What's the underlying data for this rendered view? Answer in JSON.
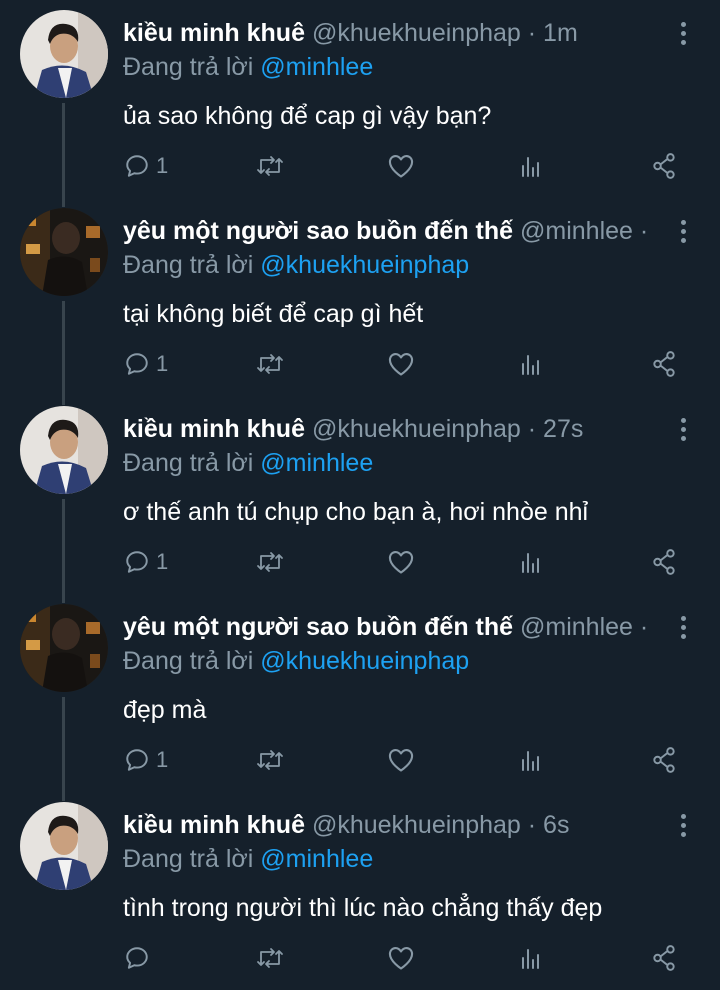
{
  "colors": {
    "background": "#15202b",
    "secondary_text": "#8899a6",
    "link": "#1da1f2",
    "thread_line": "#38444d"
  },
  "reply_prefix": "Đang trả lời",
  "tweets": [
    {
      "name": "kiều minh khuê",
      "handle": "@khuekhueinphap",
      "separator": "·",
      "time": "1m",
      "reply_to": "@minhlee",
      "text": "ủa sao không để cap gì vậy bạn?",
      "reply_count": "1",
      "avatar": "avatar-man-suit"
    },
    {
      "name": "yêu một người sao buồn đến thế",
      "handle": "@minhlee",
      "separator": "·",
      "time": "",
      "reply_to": "@khuekhueinphap",
      "text": "tại không biết để cap gì hết",
      "reply_count": "1",
      "avatar": "avatar-night-street"
    },
    {
      "name": "kiều minh khuê",
      "handle": "@khuekhueinphap",
      "separator": "·",
      "time": "27s",
      "reply_to": "@minhlee",
      "text": "ơ thế anh tú chụp cho bạn à, hơi nhòe nhỉ",
      "reply_count": "1",
      "avatar": "avatar-man-suit"
    },
    {
      "name": "yêu một người sao buồn đến thế",
      "handle": "@minhlee",
      "separator": "·",
      "time": "",
      "reply_to": "@khuekhueinphap",
      "text": "đẹp mà",
      "reply_count": "1",
      "avatar": "avatar-night-street"
    },
    {
      "name": "kiều minh khuê",
      "handle": "@khuekhueinphap",
      "separator": "·",
      "time": "6s",
      "reply_to": "@minhlee",
      "text": "tình trong người thì lúc nào chẳng thấy đẹp",
      "reply_count": "",
      "avatar": "avatar-man-suit"
    }
  ]
}
